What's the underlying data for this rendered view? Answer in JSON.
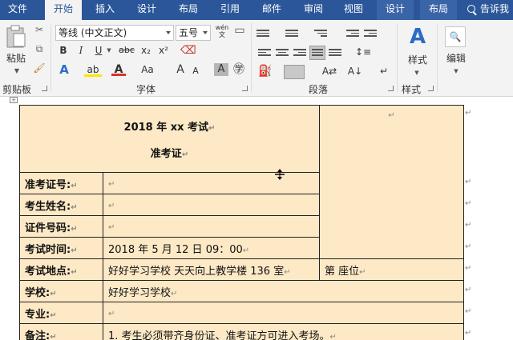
{
  "tabs": [
    {
      "label": "文件",
      "state": "normal"
    },
    {
      "label": "开始",
      "state": "active"
    },
    {
      "label": "插入",
      "state": "normal"
    },
    {
      "label": "设计",
      "state": "normal"
    },
    {
      "label": "布局",
      "state": "normal"
    },
    {
      "label": "引用",
      "state": "normal"
    },
    {
      "label": "邮件",
      "state": "normal"
    },
    {
      "label": "审阅",
      "state": "normal"
    },
    {
      "label": "视图",
      "state": "normal"
    },
    {
      "label": "设计",
      "state": "contextual"
    },
    {
      "label": "布局",
      "state": "contextual"
    }
  ],
  "tellme": "告诉我",
  "ribbon": {
    "clipboard": {
      "paste": "粘贴",
      "group": "剪贴板"
    },
    "font": {
      "family": "等线 (中文正文)",
      "size": "五号",
      "wen": "wén\n文",
      "bold": "B",
      "italic": "I",
      "underline": "U",
      "strike": "abc",
      "sub": "x₂",
      "sup": "x²",
      "case": "Aa",
      "grow": "A",
      "shrink": "A",
      "group": "字体"
    },
    "paragraph": {
      "group": "段落"
    },
    "styles": {
      "label": "样式",
      "group": "样式"
    },
    "editing": {
      "label": "编辑"
    }
  },
  "colors": {
    "tabbar": "#2b579a",
    "ribbon": "#f3f3f3",
    "cellfill": "#fde9c6",
    "fontRed": "#e0302b",
    "highlight": "#ffe600"
  },
  "document": {
    "title_line1": "2018 年 xx 考试",
    "title_line2": "准考证",
    "mark": "↵",
    "rows": [
      {
        "label": "准考证号:",
        "value": ""
      },
      {
        "label": "考生姓名:",
        "value": ""
      },
      {
        "label": "证件号码:",
        "value": ""
      },
      {
        "label": "考试时间:",
        "value": "2018 年 5 月 12 日  09：00"
      },
      {
        "label": "考试地点:",
        "value": "好好学习学校  天天向上教学楼 136 室",
        "seat": "第      座位"
      },
      {
        "label": "学校:",
        "value": "好好学习学校"
      },
      {
        "label": "专业:",
        "value": ""
      },
      {
        "label": "备注:",
        "value": "1.   考生必须带齐身份证、准考证方可进入考场。"
      }
    ]
  }
}
